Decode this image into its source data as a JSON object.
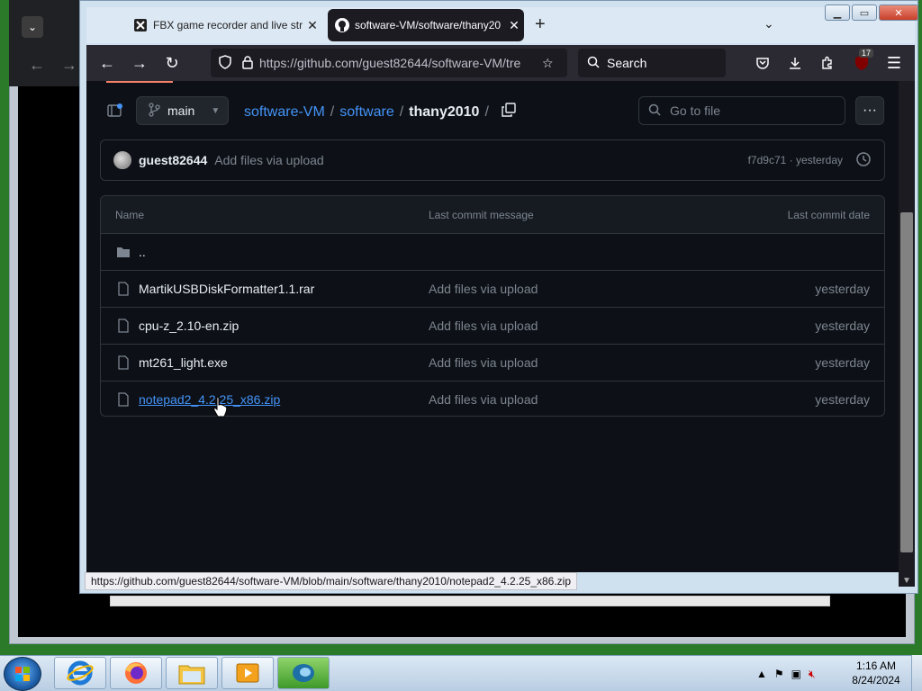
{
  "browser": {
    "tabs": [
      {
        "title": "FBX game recorder and live stre",
        "active": false
      },
      {
        "title": "software-VM/software/thany20",
        "active": true
      }
    ],
    "new_tab": "+",
    "url": "https://github.com/guest82644/software-VM/tre",
    "search_placeholder": "Search",
    "extension_badge": "17",
    "status_url": "https://github.com/guest82644/software-VM/blob/main/software/thany2010/notepad2_4.2.25_x86.zip"
  },
  "repo": {
    "branch": "main",
    "breadcrumb": {
      "owner_repo": "software-VM",
      "folder": "software",
      "current": "thany2010",
      "sep": "/"
    },
    "go_to_file_placeholder": "Go to file",
    "more": "···"
  },
  "latest_commit": {
    "author": "guest82644",
    "message": "Add files via upload",
    "hash_time": "f7d9c71 · yesterday"
  },
  "file_table": {
    "headers": {
      "name": "Name",
      "message": "Last commit message",
      "date": "Last commit date"
    },
    "parent": "..",
    "files": [
      {
        "name": "MartikUSBDiskFormatter1.1.rar",
        "message": "Add files via upload",
        "date": "yesterday"
      },
      {
        "name": "cpu-z_2.10-en.zip",
        "message": "Add files via upload",
        "date": "yesterday"
      },
      {
        "name": "mt261_light.exe",
        "message": "Add files via upload",
        "date": "yesterday"
      },
      {
        "name": "notepad2_4.2.25_x86.zip",
        "message": "Add files via upload",
        "date": "yesterday"
      }
    ]
  },
  "taskbar": {
    "time": "1:16 AM",
    "date": "8/24/2024"
  },
  "colors": {
    "page_bg": "#0d1117",
    "link": "#4493f8",
    "muted": "#7d8590",
    "toolbar": "#2b2a33"
  }
}
